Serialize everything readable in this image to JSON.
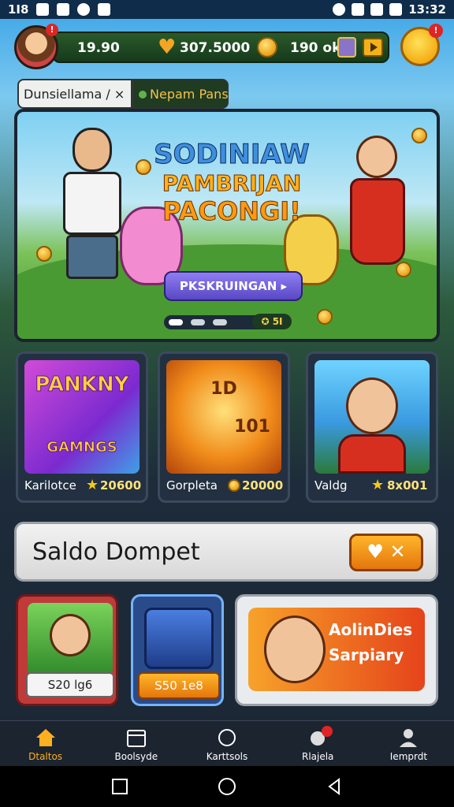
{
  "status_bar": {
    "left_text": "1I8",
    "time": "13:32"
  },
  "topbar": {
    "avatar_badge": "!",
    "stat1": "19.90",
    "stat2": "307.5000",
    "stat3": "190 ok",
    "emoji_badge": "!"
  },
  "tabs": [
    {
      "label": "Dunsiellama / ×"
    },
    {
      "label": "Nepam Pans"
    }
  ],
  "banner": {
    "title_line1": "SODINIAW",
    "title_line2": "PAMBRIJAN",
    "title_line3": "PACONGI!",
    "cta_label": "PKSKRUINGAN ▸",
    "pager_count": "✪ 5I",
    "colors": {
      "cta": "#6a57d8"
    }
  },
  "cards": [
    {
      "art_text": "PANKNY",
      "art_sub": "GAMNGS",
      "label": "Karilotce",
      "value": "20600"
    },
    {
      "art_text": "1D",
      "art_sub": "101",
      "label": "Gorpleta",
      "value": "20000"
    },
    {
      "art_text": "",
      "art_sub": "",
      "label": "Valdg",
      "value": "8x001"
    }
  ],
  "saldo": {
    "title": "Saldo Dompet",
    "button_text": "♥ ✕"
  },
  "tiles": [
    {
      "chip": "S20 lg6"
    },
    {
      "chip": "S50 1e8"
    },
    {
      "line1": "AolinDies",
      "line2": "Sarpiary"
    }
  ],
  "bottom_nav": [
    {
      "label": "Dtaltos",
      "icon": "home-icon",
      "active": true
    },
    {
      "label": "Boolsyde",
      "icon": "calendar-icon",
      "active": false
    },
    {
      "label": "Karttsols",
      "icon": "circle-icon",
      "active": false
    },
    {
      "label": "Rlajela",
      "icon": "bell-icon",
      "active": false
    },
    {
      "label": "Iemprdt",
      "icon": "person-icon",
      "active": false
    }
  ]
}
